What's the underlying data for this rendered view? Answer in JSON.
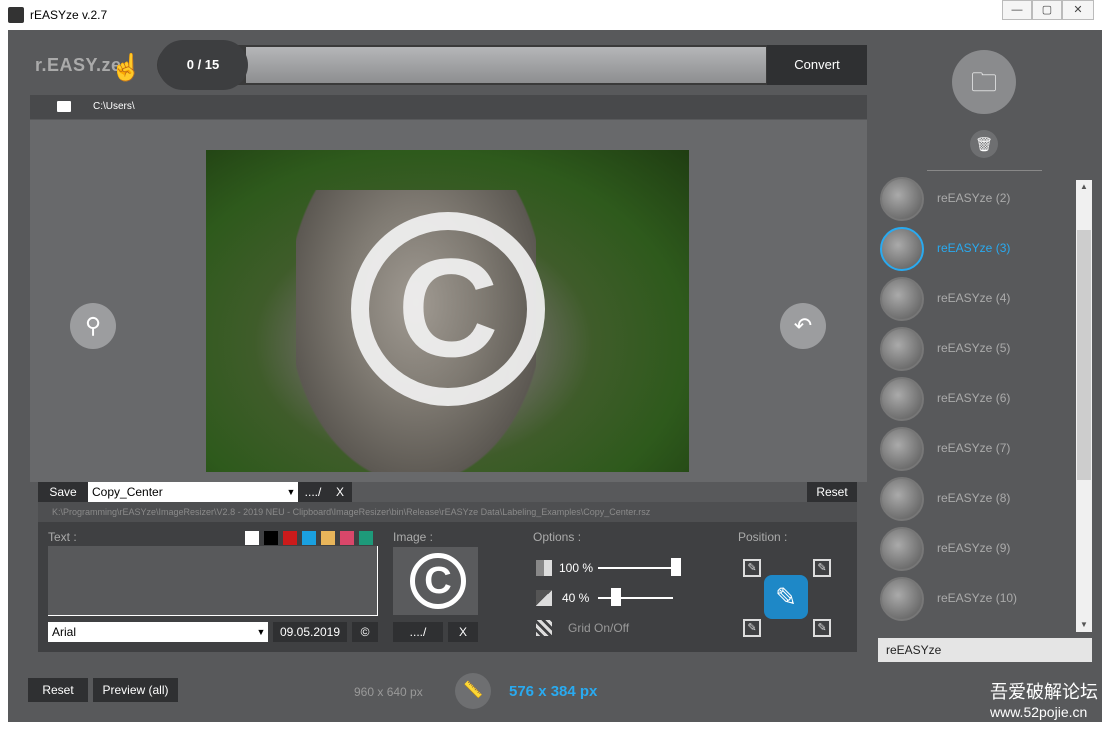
{
  "window": {
    "title": "rEASYze v.2.7",
    "min": "—",
    "max": "▢",
    "close": "✕"
  },
  "header": {
    "logo": "r.EASY.ze",
    "progress": "0 / 15",
    "progress_fraction": 0,
    "convert_label": "Convert"
  },
  "pathbar": {
    "path": "C:\\Users\\"
  },
  "preview": {
    "zoom_icon": "search-icon",
    "undo_icon": "undo-icon",
    "watermark_symbol": "C"
  },
  "toolbar": {
    "save_label": "Save",
    "preset": "Copy_Center",
    "browse_label": "..../",
    "clear_label": "X",
    "reset_label": "Reset",
    "preset_path": "K:\\Programming\\rEASYze\\ImageResizer\\V2.8 - 2019   NEU - Clipboard\\ImageResizer\\bin\\Release\\rEASYze Data\\Labeling_Examples\\Copy_Center.rsz"
  },
  "text_section": {
    "label": "Text :",
    "colors": [
      "#ffffff",
      "#000000",
      "#cc1b1b",
      "#1aa0e0",
      "#e8b55a",
      "#d9476a",
      "#1e9a7a"
    ],
    "font": "Arial",
    "date": "09.05.2019",
    "copyright_symbol": "©"
  },
  "image_section": {
    "label": "Image :",
    "symbol": "C",
    "browse_label": "..../",
    "clear_label": "X"
  },
  "options": {
    "label": "Options :",
    "opacity": "100 %",
    "opacity_value": 100,
    "size": "40 %",
    "size_value": 40,
    "grid_label": "Grid On/Off"
  },
  "position": {
    "label": "Position :"
  },
  "bottom": {
    "reset_label": "Reset",
    "preview_label": "Preview (all)",
    "original_size": "960 x 640 px",
    "new_size": "576 x 384 px"
  },
  "list": {
    "items": [
      {
        "label": "reEASYze (2)",
        "active": false
      },
      {
        "label": "reEASYze (3)",
        "active": true
      },
      {
        "label": "reEASYze (4)",
        "active": false
      },
      {
        "label": "reEASYze (5)",
        "active": false
      },
      {
        "label": "reEASYze (6)",
        "active": false
      },
      {
        "label": "reEASYze (7)",
        "active": false
      },
      {
        "label": "reEASYze (8)",
        "active": false
      },
      {
        "label": "reEASYze (9)",
        "active": false
      },
      {
        "label": "reEASYze (10)",
        "active": false
      }
    ],
    "name_value": "reEASYze"
  },
  "site_watermark": {
    "line1": "吾爱破解论坛",
    "line2": "www.52pojie.cn"
  }
}
